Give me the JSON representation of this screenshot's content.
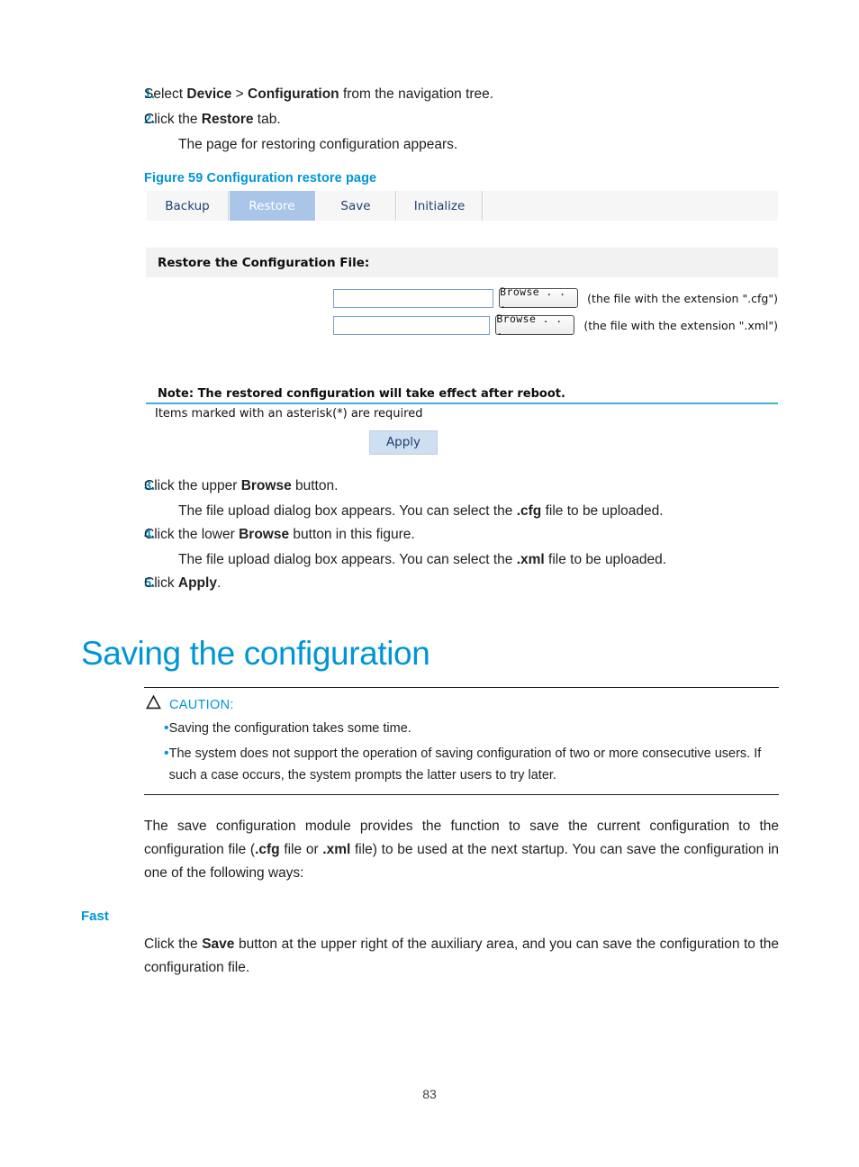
{
  "document": {
    "page_number": "83",
    "accent_color": "#0096d6"
  },
  "steps_before": [
    {
      "num": "1.",
      "parts": [
        {
          "t": "Select ",
          "b": false
        },
        {
          "t": "Device",
          "b": true
        },
        {
          "t": " > ",
          "b": false
        },
        {
          "t": "Configuration",
          "b": true
        },
        {
          "t": " from the navigation tree.",
          "b": false
        }
      ]
    },
    {
      "num": "2.",
      "parts": [
        {
          "t": "Click the ",
          "b": false
        },
        {
          "t": "Restore",
          "b": true
        },
        {
          "t": " tab.",
          "b": false
        }
      ],
      "sub": "The page for restoring configuration appears."
    }
  ],
  "figure": {
    "caption": "Figure 59 Configuration restore page",
    "tabs": [
      {
        "label": "Backup",
        "active": false
      },
      {
        "label": "Restore",
        "active": true
      },
      {
        "label": "Save",
        "active": false
      },
      {
        "label": "Initialize",
        "active": false
      }
    ],
    "section_header": "Restore the Configuration File:",
    "rows": [
      {
        "value": "",
        "placeholder": "",
        "button": "Browse . . .",
        "hint": "(the file with the extension \".cfg\")"
      },
      {
        "value": "",
        "placeholder": "",
        "button": "Browse . . .",
        "hint": "(the file with the extension \".xml\")"
      }
    ],
    "note": "Note: The restored configuration will take effect after reboot.",
    "required_note": "Items marked with an asterisk(*) are required",
    "apply_label": "Apply",
    "colors": {
      "active_tab_bg": "#a9c5e8",
      "section_header_bg": "#f2f2f2",
      "blue_rule": "#44aee0",
      "apply_bg": "#cfdff2",
      "apply_text": "#1f3f73"
    }
  },
  "steps_after": [
    {
      "num": "3.",
      "parts": [
        {
          "t": "Click the upper ",
          "b": false
        },
        {
          "t": "Browse",
          "b": true
        },
        {
          "t": " button.",
          "b": false
        }
      ],
      "sub_parts": [
        {
          "t": "The file upload dialog box appears. You can select the ",
          "b": false
        },
        {
          "t": ".cfg",
          "b": true
        },
        {
          "t": " file to be uploaded.",
          "b": false
        }
      ]
    },
    {
      "num": "4.",
      "parts": [
        {
          "t": "Click the lower ",
          "b": false
        },
        {
          "t": "Browse",
          "b": true
        },
        {
          "t": " button in this figure.",
          "b": false
        }
      ],
      "sub_parts": [
        {
          "t": "The file upload dialog box appears. You can select the ",
          "b": false
        },
        {
          "t": ".xml",
          "b": true
        },
        {
          "t": " file to be uploaded.",
          "b": false
        }
      ]
    },
    {
      "num": "5.",
      "parts": [
        {
          "t": "Click ",
          "b": false
        },
        {
          "t": "Apply",
          "b": true
        },
        {
          "t": ".",
          "b": false
        }
      ]
    }
  ],
  "heading": "Saving the configuration",
  "caution": {
    "icon": "caution-triangle-icon",
    "title": "CAUTION:",
    "items": [
      "Saving the configuration takes some time.",
      "The system does not support the operation of saving configuration of two or more consecutive users. If such a case occurs, the system prompts the latter users to try later."
    ]
  },
  "body": {
    "paragraph_parts": [
      {
        "t": "The save configuration module provides the function to save the current configuration to the configuration file (",
        "b": false
      },
      {
        "t": ".cfg",
        "b": true
      },
      {
        "t": " file or ",
        "b": false
      },
      {
        "t": ".xml",
        "b": true
      },
      {
        "t": " file) to be used at the next startup. You can save the configuration in one of the following ways:",
        "b": false
      }
    ],
    "subheading": "Fast",
    "fast_parts": [
      {
        "t": "Click the ",
        "b": false
      },
      {
        "t": "Save",
        "b": true
      },
      {
        "t": " button at the upper right of the auxiliary area, and you can save the configuration to the configuration file.",
        "b": false
      }
    ]
  }
}
